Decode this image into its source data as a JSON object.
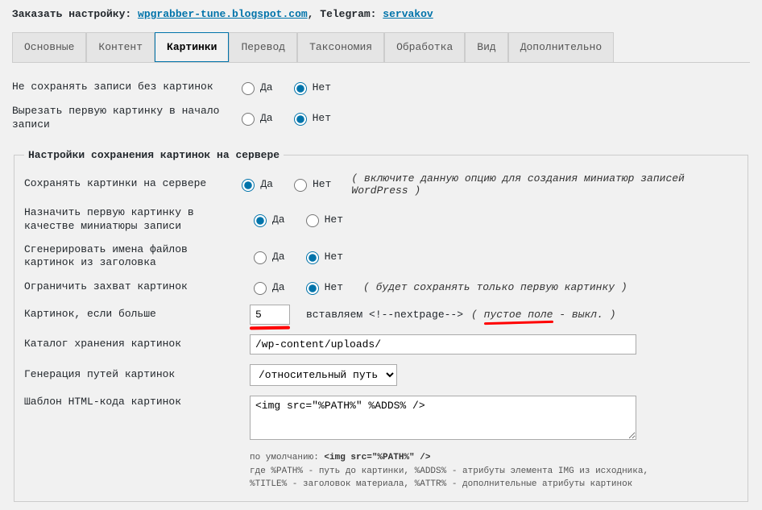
{
  "header": {
    "prefix": "Заказать настройку: ",
    "link1": "wpgrabber-tune.blogspot.com",
    "middle": ", Telegram: ",
    "link2": "servakov"
  },
  "tabs": [
    "Основные",
    "Контент",
    "Картинки",
    "Перевод",
    "Таксономия",
    "Обработка",
    "Вид",
    "Дополнительно"
  ],
  "active_tab": 2,
  "yes": "Да",
  "no": "Нет",
  "top_rows": [
    {
      "label": "Не сохранять записи без картинок",
      "value": "no"
    },
    {
      "label": "Вырезать первую картинку в начало записи",
      "value": "no"
    }
  ],
  "fieldset": {
    "legend": "Настройки сохранения картинок на сервере",
    "rows": [
      {
        "label": "Сохранять картинки на сервере",
        "value": "yes",
        "hint": "( включите данную опцию для создания миниатюр записей WordPress )"
      },
      {
        "label": "Назначить первую картинку в качестве миниатюры записи",
        "value": "yes",
        "hint": ""
      },
      {
        "label": "Сгенерировать имена файлов картинок из заголовка",
        "value": "no",
        "hint": ""
      },
      {
        "label": "Ограничить захват картинок",
        "value": "no",
        "hint": "( будет сохранять только первую картинку )"
      }
    ],
    "num_row": {
      "label": "Картинок, если больше",
      "value": "5",
      "after": "вставляем <!--nextpage-->",
      "hint": "( пустое поле - выкл. )"
    },
    "dir_row": {
      "label": "Каталог хранения картинок",
      "value": "/wp-content/uploads/"
    },
    "path_row": {
      "label": "Генерация путей картинок",
      "options": [
        "/относительный путь"
      ],
      "selected": "/относительный путь"
    },
    "tpl_row": {
      "label": "Шаблон HTML-кода картинок",
      "value": "<img src=\"%PATH%\" %ADDS% />"
    },
    "notes": {
      "l1_a": "по умолчанию: ",
      "l1_b": "<img src=\"%PATH%\" />",
      "l2": "где %PATH% - путь до картинки, %ADDS% - атрибуты элемента IMG из исходника,",
      "l3": "%TITLE% - заголовок материала, %ATTR% - дополнительные атрибуты картинок"
    }
  }
}
